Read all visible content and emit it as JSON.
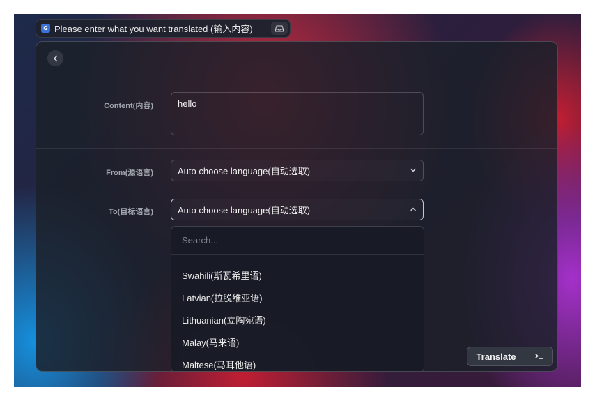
{
  "searchbar": {
    "query": "Please enter what you want translated (输入内容)",
    "app_icon_name": "translate-app-icon",
    "tray_icon_name": "tray-icon"
  },
  "form": {
    "back_icon": "chevron-left-icon",
    "content_label": "Content(内容)",
    "content_value": "hello",
    "from_label": "From(源语言)",
    "from_value": "Auto choose language(自动选取)",
    "to_label": "To(目标语言)",
    "to_value": "Auto choose language(自动选取)"
  },
  "dropdown": {
    "search_placeholder": "Search...",
    "items": [
      "Swahili(斯瓦希里语)",
      "Latvian(拉脱维亚语)",
      "Lithuanian(立陶宛语)",
      "Malay(马来语)",
      "Maltese(马耳他语)"
    ]
  },
  "actions": {
    "translate_label": "Translate",
    "shortcut_icon": "terminal-icon"
  }
}
